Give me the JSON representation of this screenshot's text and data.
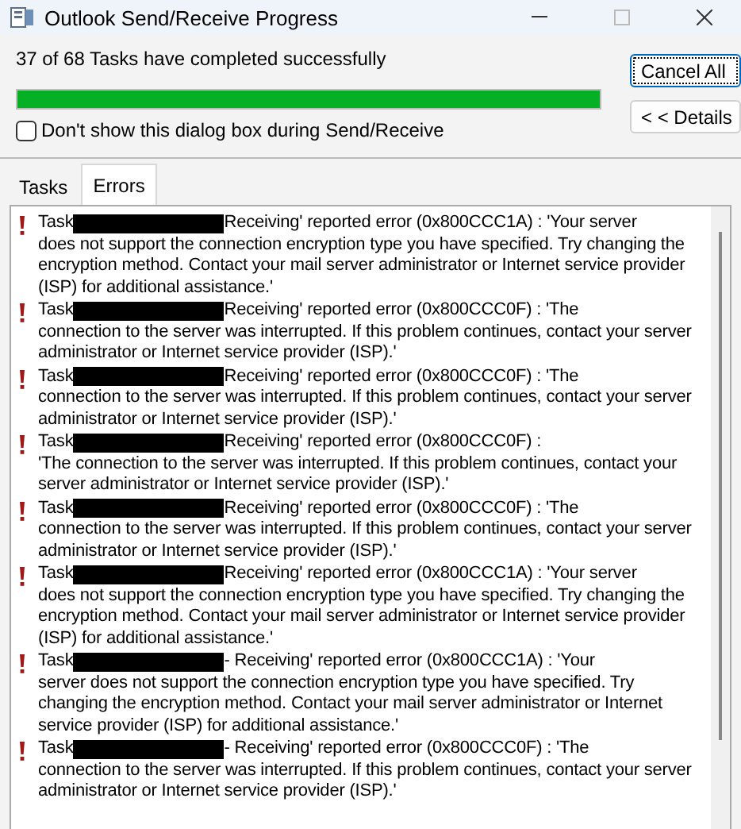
{
  "window": {
    "title": "Outlook Send/Receive Progress"
  },
  "status": "37 of 68 Tasks have completed successfully",
  "progress": {
    "level": 1.0
  },
  "buttons": [
    {
      "label": "Cancel All",
      "focused": true
    },
    {
      "label": "< < Details",
      "focused": false
    }
  ],
  "option": {
    "label": "Don't show this dialog box during Send/Receive",
    "checked": false
  },
  "tabs": [
    {
      "label": "Tasks",
      "selected": false
    },
    {
      "label": "Errors",
      "selected": true
    }
  ],
  "errors": [
    {
      "task": "Task",
      "head": "Receiving' reported error (0x800CCC1A) : 'Your server",
      "message": "does not support the connection encryption type you have specified. Try changing the encryption method. Contact your mail server administrator or Internet service provider (ISP) for additional assistance.'"
    },
    {
      "task": "Task",
      "head": "Receiving' reported error (0x800CCC0F) : 'The",
      "message": "connection to the server was interrupted. If this problem continues, contact your server administrator or Internet service provider (ISP).'"
    },
    {
      "task": "Task",
      "head": "Receiving' reported error (0x800CCC0F) : 'The",
      "message": "connection to the server was interrupted. If this problem continues, contact your server administrator or Internet service provider (ISP).'"
    },
    {
      "task": "Task",
      "head": "Receiving' reported error (0x800CCC0F) :",
      "message": "'The connection to the server was interrupted. If this problem continues, contact your server administrator or Internet service provider (ISP).'"
    },
    {
      "task": "Task",
      "head": "Receiving' reported error (0x800CCC0F) : 'The",
      "message": "connection to the server was interrupted. If this problem continues, contact your server administrator or Internet service provider (ISP).'"
    },
    {
      "task": "Task",
      "head": "Receiving' reported error (0x800CCC1A) : 'Your server",
      "message": "does not support the connection encryption type you have specified. Try changing the encryption method. Contact your mail server administrator or Internet service provider (ISP) for additional assistance.'"
    },
    {
      "task": "Task",
      "head": "- Receiving' reported error (0x800CCC1A) : 'Your",
      "message": "server does not support the connection encryption type you have specified. Try changing the encryption method. Contact your mail server administrator or Internet service provider (ISP) for additional assistance.'"
    },
    {
      "task": "Task",
      "head": "- Receiving' reported error (0x800CCC0F) : 'The",
      "message": "connection to the server was interrupted. If this problem continues, contact your server administrator or Internet service provider (ISP).'"
    }
  ]
}
